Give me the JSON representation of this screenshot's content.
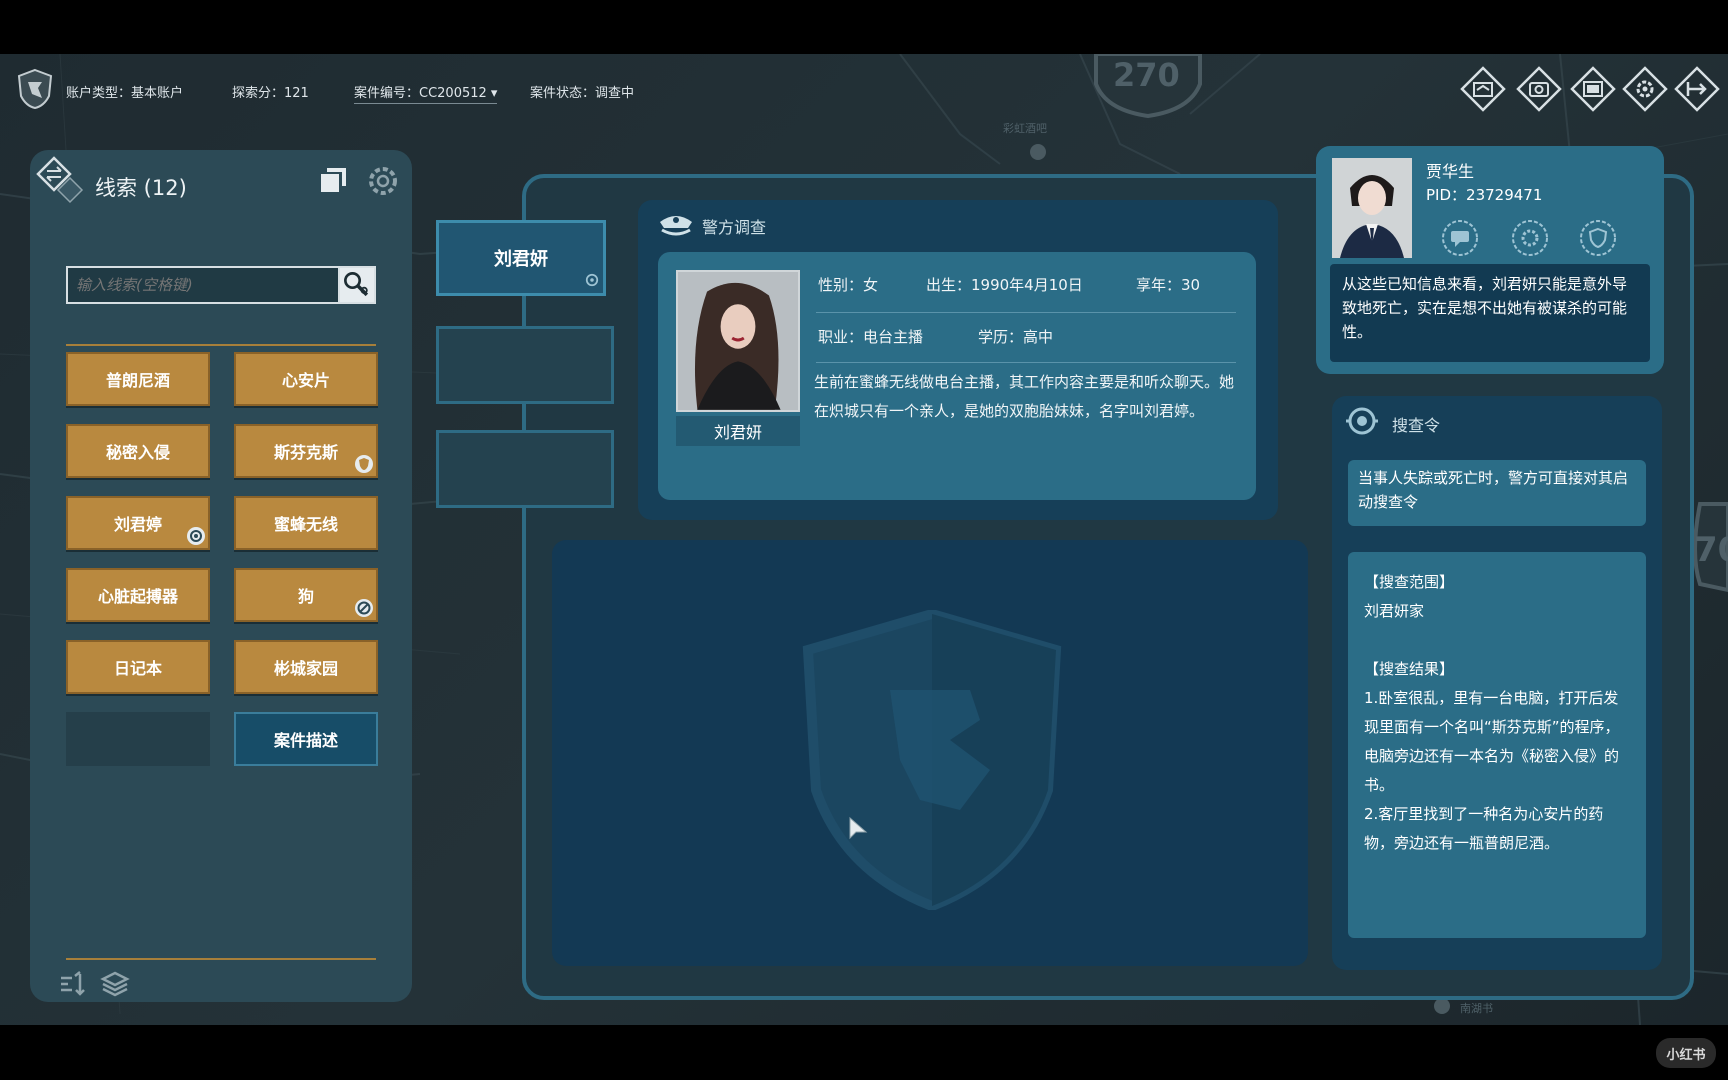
{
  "status_bar": {
    "account_type": "账户类型：基本账户",
    "exploration_score": "探索分：121",
    "case_number": "案件编号：CC200512 ▾",
    "case_status": "案件状态：调查中"
  },
  "top_icons": [
    "clue-board-icon",
    "camera-icon",
    "screen-icon",
    "settings-icon",
    "exit-icon"
  ],
  "map": {
    "highway_label": "270",
    "highway_label_right": "70",
    "place_top": "彩虹酒吧",
    "place_bottom": "南湖书"
  },
  "clue_panel": {
    "title": "线索 (12)",
    "search_placeholder": "输入线索(空格键)",
    "clues": [
      {
        "label": "普朗尼酒"
      },
      {
        "label": "心安片"
      },
      {
        "label": "秘密入侵"
      },
      {
        "label": "斯芬克斯"
      },
      {
        "label": "刘君婷"
      },
      {
        "label": "蜜蜂无线"
      },
      {
        "label": "心脏起搏器"
      },
      {
        "label": "狗"
      },
      {
        "label": "日记本"
      },
      {
        "label": "彬城家园"
      }
    ],
    "case_description_button": "案件描述"
  },
  "tabs": [
    {
      "label": "刘君妍"
    }
  ],
  "police_investigation": {
    "title": "警方调查",
    "photo_caption": "刘君妍",
    "gender": "性别：女",
    "birth": "出生：1990年4月10日",
    "age": "享年：30",
    "job": "职业：电台主播",
    "education": "学历：高中",
    "bio": "生前在蜜蜂无线做电台主播，其工作内容主要是和听众聊天。她在炽城只有一个亲人，是她的双胞胎妹妹，名字叫刘君婷。"
  },
  "character": {
    "name": "贾华生",
    "pid": "PID：23729471",
    "quote": "从这些已知信息来看，刘君妍只能是意外导致地死亡，实在是想不出她有被谋杀的可能性。"
  },
  "search_warrant": {
    "title": "搜查令",
    "note": "当事人失踪或死亡时，警方可直接对其启动搜查令",
    "scope_heading": "【搜查范围】",
    "scope_value": "刘君妍家",
    "result_heading": "【搜查结果】",
    "result_1": "1.卧室很乱，里有一台电脑，打开后发现里面有一个名叫“斯芬克斯”的程序，电脑旁边还有一本名为《秘密入侵》的书。",
    "result_2": "2.客厅里找到了一种名为心安片的药物，旁边还有一瓶普朗尼酒。"
  },
  "watermark": "小红书",
  "colors": {
    "panel": "#2c4a56",
    "accent_gold": "#b9893f",
    "accent_blue": "#2b6d87",
    "deep_blue": "#163f58",
    "frame": "#2e6b84"
  }
}
